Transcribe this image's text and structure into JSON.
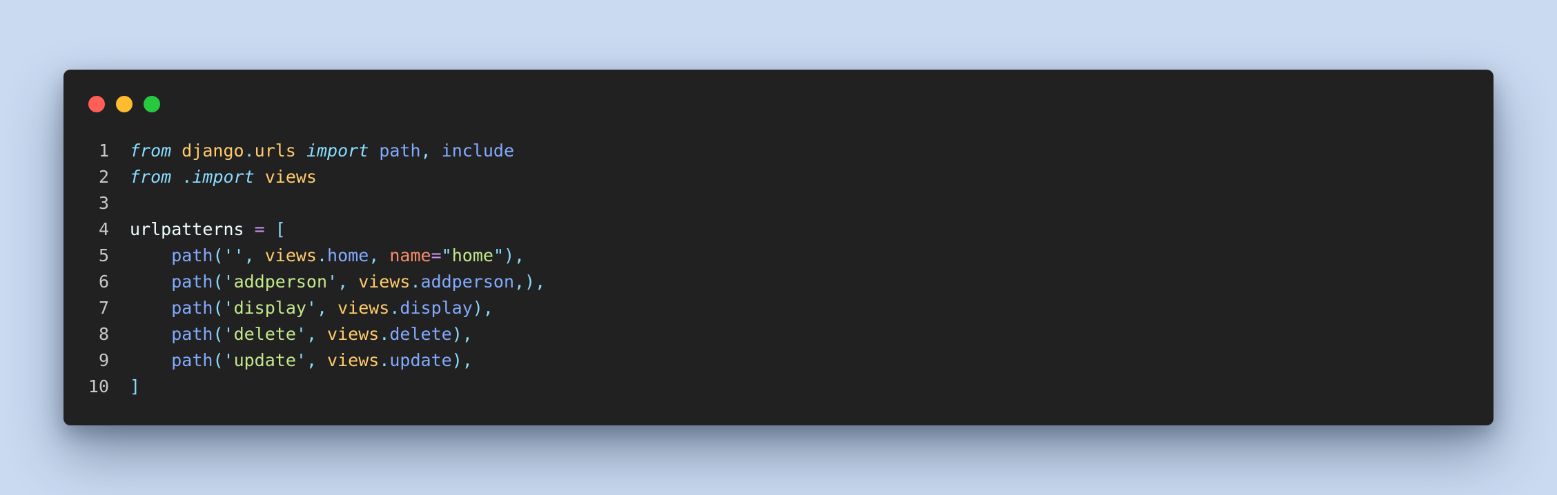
{
  "window": {
    "buttons": {
      "close_color": "#ff5f57",
      "minimize_color": "#febc2e",
      "maximize_color": "#28c840"
    }
  },
  "code": {
    "language": "python",
    "lines": [
      {
        "number": "1",
        "tokens": [
          {
            "text": "from",
            "type": "kw-italic"
          },
          {
            "text": " ",
            "type": "plain"
          },
          {
            "text": "django",
            "type": "mod"
          },
          {
            "text": ".",
            "type": "punc"
          },
          {
            "text": "urls",
            "type": "mod"
          },
          {
            "text": " ",
            "type": "plain"
          },
          {
            "text": "import",
            "type": "kw-italic"
          },
          {
            "text": " ",
            "type": "plain"
          },
          {
            "text": "path",
            "type": "fn"
          },
          {
            "text": ", ",
            "type": "punc"
          },
          {
            "text": "include",
            "type": "fn"
          }
        ]
      },
      {
        "number": "2",
        "tokens": [
          {
            "text": "from",
            "type": "kw-italic"
          },
          {
            "text": " ",
            "type": "plain"
          },
          {
            "text": ".",
            "type": "punc"
          },
          {
            "text": "import",
            "type": "kw-italic"
          },
          {
            "text": " ",
            "type": "plain"
          },
          {
            "text": "views",
            "type": "mod"
          }
        ]
      },
      {
        "number": "3",
        "tokens": []
      },
      {
        "number": "4",
        "tokens": [
          {
            "text": "urlpatterns",
            "type": "plain"
          },
          {
            "text": " ",
            "type": "plain"
          },
          {
            "text": "=",
            "type": "op"
          },
          {
            "text": " ",
            "type": "plain"
          },
          {
            "text": "[",
            "type": "punc"
          }
        ]
      },
      {
        "number": "5",
        "tokens": [
          {
            "text": "    ",
            "type": "plain"
          },
          {
            "text": "path",
            "type": "fn"
          },
          {
            "text": "(",
            "type": "punc"
          },
          {
            "text": "''",
            "type": "punc"
          },
          {
            "text": ", ",
            "type": "punc"
          },
          {
            "text": "views",
            "type": "mod"
          },
          {
            "text": ".",
            "type": "punc"
          },
          {
            "text": "home",
            "type": "fn"
          },
          {
            "text": ", ",
            "type": "punc"
          },
          {
            "text": "name",
            "type": "param"
          },
          {
            "text": "=",
            "type": "op"
          },
          {
            "text": "\"",
            "type": "punc"
          },
          {
            "text": "home",
            "type": "str"
          },
          {
            "text": "\"",
            "type": "punc"
          },
          {
            "text": "),",
            "type": "punc"
          }
        ]
      },
      {
        "number": "6",
        "tokens": [
          {
            "text": "    ",
            "type": "plain"
          },
          {
            "text": "path",
            "type": "fn"
          },
          {
            "text": "(",
            "type": "punc"
          },
          {
            "text": "'",
            "type": "punc"
          },
          {
            "text": "addperson",
            "type": "str"
          },
          {
            "text": "'",
            "type": "punc"
          },
          {
            "text": ", ",
            "type": "punc"
          },
          {
            "text": "views",
            "type": "mod"
          },
          {
            "text": ".",
            "type": "punc"
          },
          {
            "text": "addperson",
            "type": "fn"
          },
          {
            "text": ",),",
            "type": "punc"
          }
        ]
      },
      {
        "number": "7",
        "tokens": [
          {
            "text": "    ",
            "type": "plain"
          },
          {
            "text": "path",
            "type": "fn"
          },
          {
            "text": "(",
            "type": "punc"
          },
          {
            "text": "'",
            "type": "punc"
          },
          {
            "text": "display",
            "type": "str"
          },
          {
            "text": "'",
            "type": "punc"
          },
          {
            "text": ", ",
            "type": "punc"
          },
          {
            "text": "views",
            "type": "mod"
          },
          {
            "text": ".",
            "type": "punc"
          },
          {
            "text": "display",
            "type": "fn"
          },
          {
            "text": "),",
            "type": "punc"
          }
        ]
      },
      {
        "number": "8",
        "tokens": [
          {
            "text": "    ",
            "type": "plain"
          },
          {
            "text": "path",
            "type": "fn"
          },
          {
            "text": "(",
            "type": "punc"
          },
          {
            "text": "'",
            "type": "punc"
          },
          {
            "text": "delete",
            "type": "str"
          },
          {
            "text": "'",
            "type": "punc"
          },
          {
            "text": ", ",
            "type": "punc"
          },
          {
            "text": "views",
            "type": "mod"
          },
          {
            "text": ".",
            "type": "punc"
          },
          {
            "text": "delete",
            "type": "fn"
          },
          {
            "text": "),",
            "type": "punc"
          }
        ]
      },
      {
        "number": "9",
        "tokens": [
          {
            "text": "    ",
            "type": "plain"
          },
          {
            "text": "path",
            "type": "fn"
          },
          {
            "text": "(",
            "type": "punc"
          },
          {
            "text": "'",
            "type": "punc"
          },
          {
            "text": "update",
            "type": "str"
          },
          {
            "text": "'",
            "type": "punc"
          },
          {
            "text": ", ",
            "type": "punc"
          },
          {
            "text": "views",
            "type": "mod"
          },
          {
            "text": ".",
            "type": "punc"
          },
          {
            "text": "update",
            "type": "fn"
          },
          {
            "text": "),",
            "type": "punc"
          }
        ]
      },
      {
        "number": "10",
        "tokens": [
          {
            "text": "]",
            "type": "punc"
          }
        ]
      }
    ]
  }
}
